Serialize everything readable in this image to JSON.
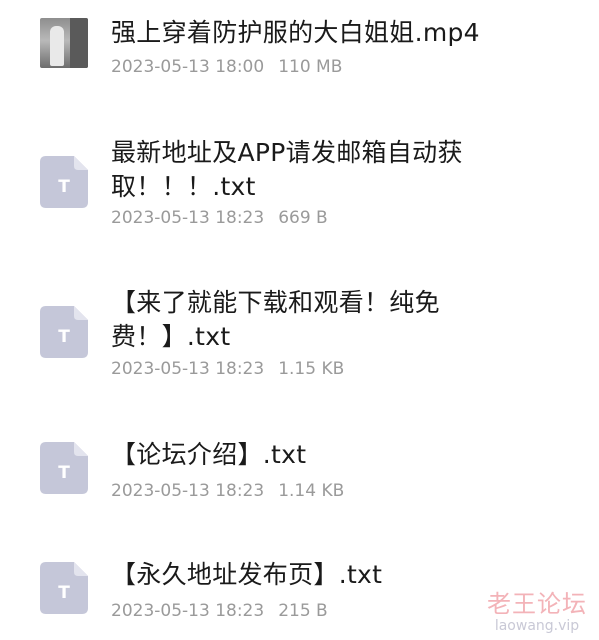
{
  "files": [
    {
      "name": "强上穿着防护服的大白姐姐.mp4",
      "date": "2023-05-13 18:00",
      "size": "110 MB",
      "icon": "video-thumbnail"
    },
    {
      "name": "最新地址及APP请发邮箱自动获取！！！.txt",
      "date": "2023-05-13 18:23",
      "size": "669 B",
      "icon": "txt-file-icon",
      "icon_letter": "T"
    },
    {
      "name": "【来了就能下载和观看！纯免费！】.txt",
      "date": "2023-05-13 18:23",
      "size": "1.15 KB",
      "icon": "txt-file-icon",
      "icon_letter": "T"
    },
    {
      "name": "【论坛介绍】.txt",
      "date": "2023-05-13 18:23",
      "size": "1.14 KB",
      "icon": "txt-file-icon",
      "icon_letter": "T"
    },
    {
      "name": "【永久地址发布页】.txt",
      "date": "2023-05-13 18:23",
      "size": "215 B",
      "icon": "txt-file-icon",
      "icon_letter": "T"
    }
  ],
  "watermark": {
    "title": "老王论坛",
    "subtitle": "laowang.vip"
  },
  "colors": {
    "icon_fill": "#c5c7d9",
    "icon_fold": "#e3e4ee",
    "title_text": "#1a1a1a",
    "meta_text": "#9a9a9a"
  }
}
